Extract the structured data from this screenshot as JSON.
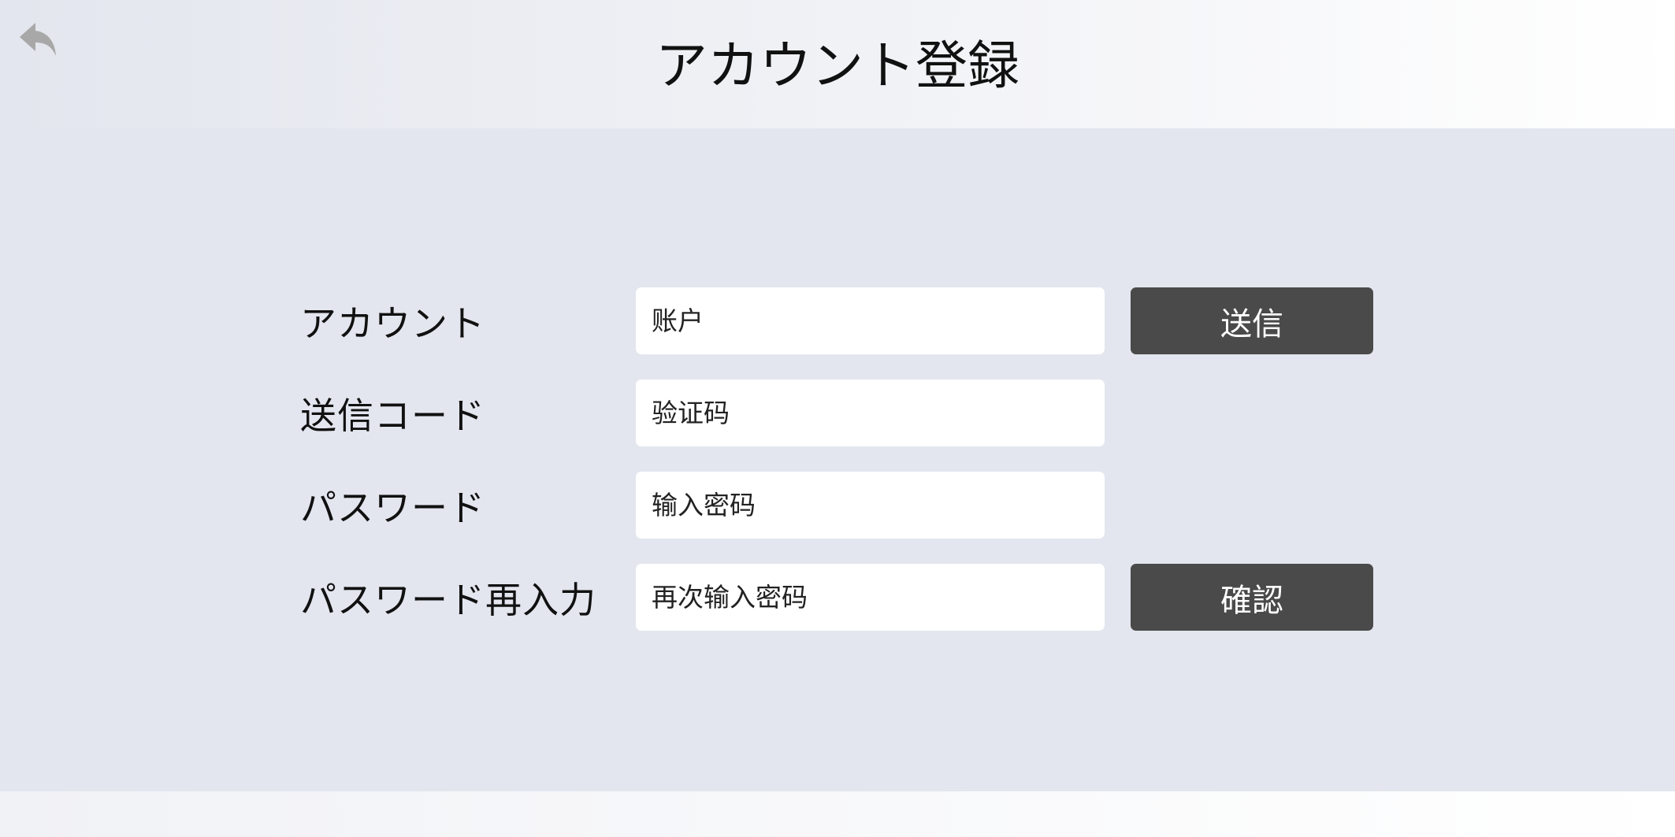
{
  "header": {
    "title": "アカウント登録",
    "back_icon": "back-arrow-icon"
  },
  "form": {
    "account": {
      "label": "アカウント",
      "placeholder": "账户"
    },
    "code": {
      "label": "送信コード",
      "placeholder": "验证码"
    },
    "password": {
      "label": "パスワード",
      "placeholder": "输入密码"
    },
    "password_confirm": {
      "label": "パスワード再入力",
      "placeholder": "再次输入密码"
    }
  },
  "buttons": {
    "send_label": "送信",
    "confirm_label": "確認"
  },
  "colors": {
    "background": "#e3e6ee",
    "button": "#4a4a4a",
    "field": "#ffffff",
    "icon": "#a8a8a8"
  }
}
